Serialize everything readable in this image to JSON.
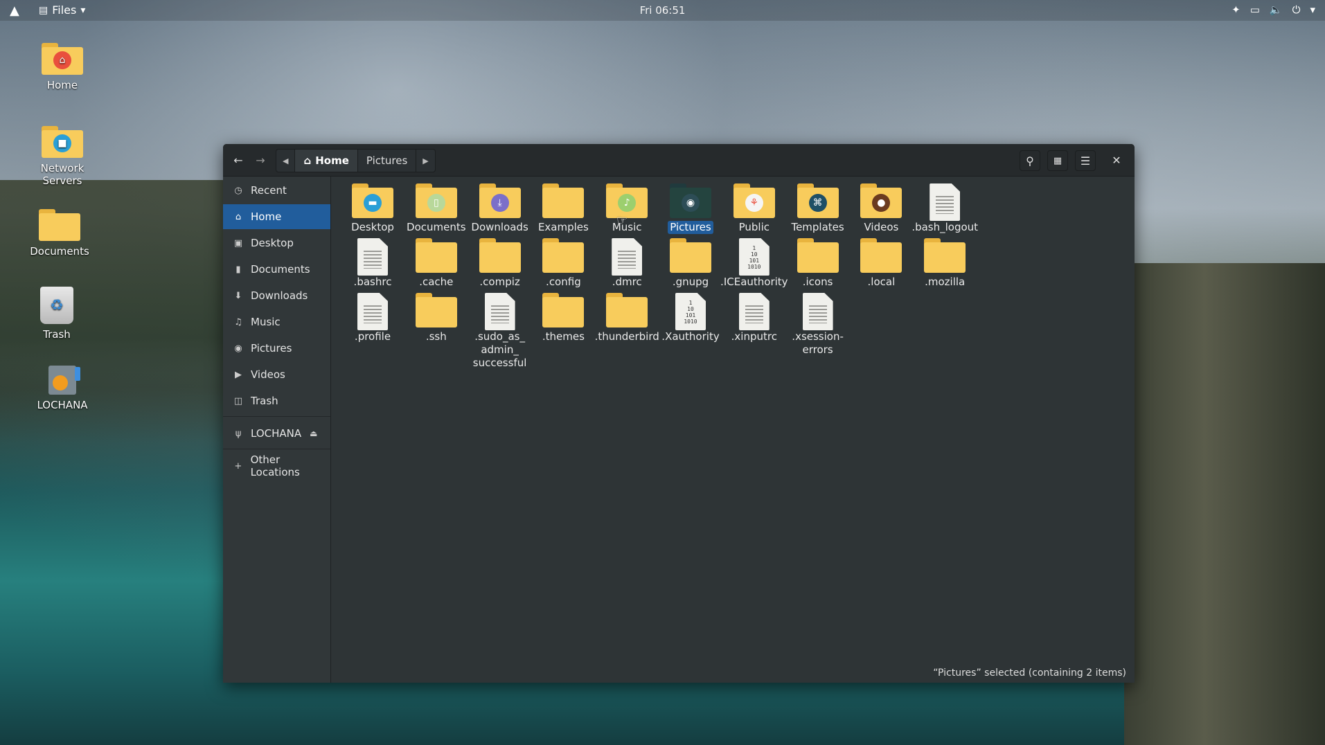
{
  "topbar": {
    "app_menu": "Files",
    "clock": "Fri 06:51",
    "tray_icons": [
      "accessibility-icon",
      "display-icon",
      "volume-icon",
      "power-icon"
    ]
  },
  "desktop": {
    "icons": [
      {
        "label": "Home"
      },
      {
        "label": "Network Servers"
      },
      {
        "label": "Documents"
      },
      {
        "label": "Trash"
      },
      {
        "label": "LOCHANA"
      }
    ]
  },
  "window": {
    "breadcrumb": {
      "home": "Home",
      "current": "Pictures"
    },
    "sidebar": {
      "items": [
        {
          "label": "Recent",
          "icon": "clock-icon"
        },
        {
          "label": "Home",
          "icon": "home-icon"
        },
        {
          "label": "Desktop",
          "icon": "desktop-icon"
        },
        {
          "label": "Documents",
          "icon": "document-icon"
        },
        {
          "label": "Downloads",
          "icon": "download-icon"
        },
        {
          "label": "Music",
          "icon": "headphones-icon"
        },
        {
          "label": "Pictures",
          "icon": "camera-icon"
        },
        {
          "label": "Videos",
          "icon": "video-icon"
        },
        {
          "label": "Trash",
          "icon": "trash-icon"
        },
        {
          "label": "LOCHANA",
          "icon": "usb-icon"
        },
        {
          "label": "Other Locations",
          "icon": "plus-icon"
        }
      ],
      "active": "Home"
    },
    "files": [
      {
        "name": "Desktop",
        "type": "folder",
        "emblem": "desktop"
      },
      {
        "name": "Documents",
        "type": "folder",
        "emblem": "document"
      },
      {
        "name": "Downloads",
        "type": "folder",
        "emblem": "download"
      },
      {
        "name": "Examples",
        "type": "folder"
      },
      {
        "name": "Music",
        "type": "folder",
        "emblem": "music"
      },
      {
        "name": "Pictures",
        "type": "folder",
        "emblem": "camera",
        "selected": true
      },
      {
        "name": "Public",
        "type": "folder",
        "emblem": "share"
      },
      {
        "name": "Templates",
        "type": "folder",
        "emblem": "template"
      },
      {
        "name": "Videos",
        "type": "folder",
        "emblem": "video"
      },
      {
        "name": ".bash_logout",
        "type": "text"
      },
      {
        "name": ".bashrc",
        "type": "text"
      },
      {
        "name": ".cache",
        "type": "folder"
      },
      {
        "name": ".compiz",
        "type": "folder"
      },
      {
        "name": ".config",
        "type": "folder"
      },
      {
        "name": ".dmrc",
        "type": "text"
      },
      {
        "name": ".gnupg",
        "type": "folder"
      },
      {
        "name": ".ICEauthority",
        "type": "binary"
      },
      {
        "name": ".icons",
        "type": "folder"
      },
      {
        "name": ".local",
        "type": "folder"
      },
      {
        "name": ".mozilla",
        "type": "folder"
      },
      {
        "name": ".profile",
        "type": "text"
      },
      {
        "name": ".ssh",
        "type": "folder"
      },
      {
        "name": ".sudo_as_ admin_ successful",
        "type": "text"
      },
      {
        "name": ".themes",
        "type": "folder"
      },
      {
        "name": ".thunderbird",
        "type": "folder"
      },
      {
        "name": ".Xauthority",
        "type": "binary"
      },
      {
        "name": ".xinputrc",
        "type": "text"
      },
      {
        "name": ".xsession- errors",
        "type": "text"
      }
    ],
    "status": "“Pictures” selected  (containing 2 items)"
  }
}
